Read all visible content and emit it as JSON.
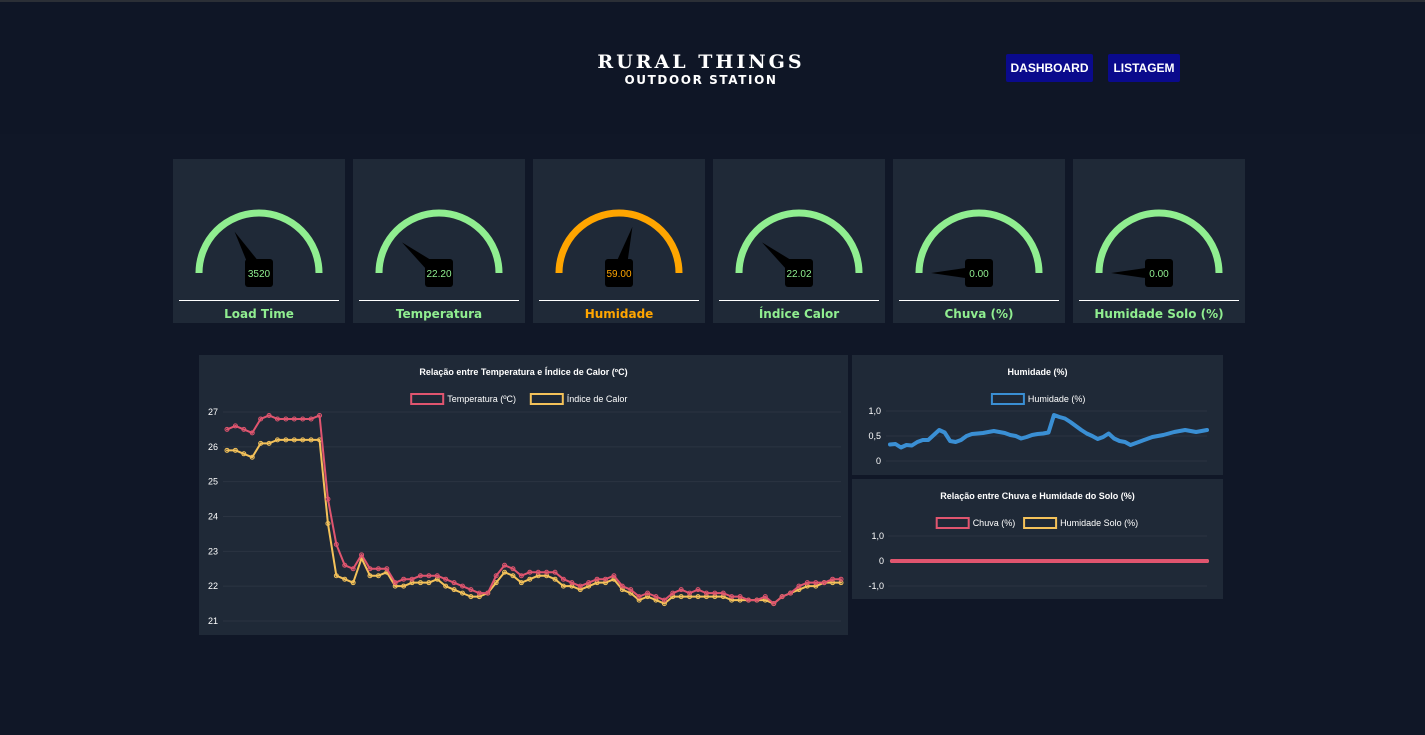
{
  "header": {
    "title": "RURAL THINGS",
    "subtitle": "OUTDOOR STATION",
    "nav": [
      {
        "label": "DASHBOARD"
      },
      {
        "label": "LISTAGEM"
      }
    ]
  },
  "gauges": [
    {
      "label": "Load Time",
      "value": "3520",
      "color": "#90ee90",
      "needle_fraction": 0.33
    },
    {
      "label": "Temperatura",
      "value": "22.20",
      "color": "#90ee90",
      "needle_fraction": 0.22
    },
    {
      "label": "Humidade",
      "value": "59.00",
      "color": "#ffa500",
      "needle_fraction": 0.59
    },
    {
      "label": "Índice Calor",
      "value": "22.02",
      "color": "#90ee90",
      "needle_fraction": 0.22
    },
    {
      "label": "Chuva (%)",
      "value": "0.00",
      "color": "#90ee90",
      "needle_fraction": 0.0
    },
    {
      "label": "Humidade Solo (%)",
      "value": "0.00",
      "color": "#90ee90",
      "needle_fraction": 0.0
    }
  ],
  "chart_data": [
    {
      "type": "line",
      "title": "Relação entre Temperatura e Índice de Calor (ºC)",
      "ylim": [
        21,
        27
      ],
      "y_ticks": [
        "27",
        "26",
        "25",
        "24",
        "23",
        "22",
        "21"
      ],
      "grid": true,
      "legend": "top",
      "series": [
        {
          "name": "Temperatura (ºC)",
          "color": "#e0556f",
          "values": [
            26.5,
            26.6,
            26.5,
            26.4,
            26.8,
            26.9,
            26.8,
            26.8,
            26.8,
            26.8,
            26.8,
            26.9,
            24.5,
            23.2,
            22.6,
            22.5,
            22.9,
            22.5,
            22.5,
            22.5,
            22.1,
            22.2,
            22.2,
            22.3,
            22.3,
            22.3,
            22.2,
            22.1,
            22.0,
            21.9,
            21.8,
            21.8,
            22.3,
            22.6,
            22.5,
            22.3,
            22.4,
            22.4,
            22.4,
            22.4,
            22.2,
            22.1,
            22.0,
            22.1,
            22.2,
            22.2,
            22.3,
            22.0,
            21.9,
            21.7,
            21.8,
            21.7,
            21.6,
            21.8,
            21.9,
            21.8,
            21.9,
            21.8,
            21.8,
            21.8,
            21.7,
            21.7,
            21.6,
            21.6,
            21.7,
            21.5,
            21.7,
            21.8,
            22.0,
            22.1,
            22.1,
            22.1,
            22.2,
            22.2
          ]
        },
        {
          "name": "Índice de Calor",
          "color": "#f4c25a",
          "values": [
            25.9,
            25.9,
            25.8,
            25.7,
            26.1,
            26.1,
            26.2,
            26.2,
            26.2,
            26.2,
            26.2,
            26.2,
            23.8,
            22.3,
            22.2,
            22.1,
            22.8,
            22.3,
            22.3,
            22.4,
            22.0,
            22.0,
            22.1,
            22.1,
            22.1,
            22.2,
            22.0,
            21.9,
            21.8,
            21.7,
            21.7,
            21.8,
            22.1,
            22.4,
            22.3,
            22.1,
            22.2,
            22.3,
            22.3,
            22.2,
            22.0,
            22.0,
            21.9,
            22.0,
            22.1,
            22.1,
            22.2,
            21.9,
            21.8,
            21.6,
            21.7,
            21.6,
            21.5,
            21.7,
            21.7,
            21.7,
            21.7,
            21.7,
            21.7,
            21.7,
            21.6,
            21.6,
            21.6,
            21.6,
            21.6,
            21.5,
            21.7,
            21.8,
            21.9,
            22.0,
            22.0,
            22.1,
            22.1,
            22.1
          ]
        }
      ]
    },
    {
      "type": "line",
      "title": "Humidade (%)",
      "ylim": [
        0,
        1
      ],
      "y_ticks": [
        "1,0",
        "0,5",
        "0"
      ],
      "grid": true,
      "legend": "top",
      "series": [
        {
          "name": "Humidade (%)",
          "color": "#3a8fd4",
          "values": [
            0.33,
            0.34,
            0.27,
            0.32,
            0.31,
            0.38,
            0.42,
            0.42,
            0.52,
            0.62,
            0.57,
            0.4,
            0.38,
            0.42,
            0.5,
            0.54,
            0.55,
            0.56,
            0.58,
            0.6,
            0.58,
            0.56,
            0.52,
            0.5,
            0.45,
            0.48,
            0.52,
            0.54,
            0.55,
            0.57,
            0.92,
            0.88,
            0.85,
            0.78,
            0.7,
            0.62,
            0.55,
            0.5,
            0.44,
            0.48,
            0.55,
            0.45,
            0.4,
            0.38,
            0.32,
            0.36,
            0.4,
            0.44,
            0.48,
            0.5,
            0.52,
            0.55,
            0.58,
            0.6,
            0.62,
            0.6,
            0.58,
            0.6,
            0.62
          ]
        }
      ]
    },
    {
      "type": "line",
      "title": "Relação entre Chuva e Humidade do Solo (%)",
      "ylim": [
        -1,
        1
      ],
      "y_ticks": [
        "1,0",
        "0",
        "-1,0"
      ],
      "grid": true,
      "legend": "top",
      "series": [
        {
          "name": "Chuva (%)",
          "color": "#e0556f",
          "values": [
            0,
            0,
            0,
            0,
            0,
            0,
            0,
            0,
            0,
            0,
            0,
            0,
            0,
            0,
            0,
            0,
            0,
            0,
            0,
            0
          ]
        },
        {
          "name": "Humidade Solo (%)",
          "color": "#f4c25a",
          "values": [
            0,
            0,
            0,
            0,
            0,
            0,
            0,
            0,
            0,
            0,
            0,
            0,
            0,
            0,
            0,
            0,
            0,
            0,
            0,
            0
          ]
        }
      ]
    }
  ]
}
